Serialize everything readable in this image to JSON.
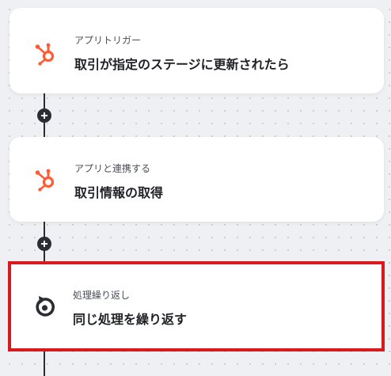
{
  "flow": {
    "steps": [
      {
        "app_label": "アプリトリガー",
        "title": "取引が指定のステージに更新されたら",
        "icon": "hubspot-icon",
        "icon_color": "#ff5c35"
      },
      {
        "app_label": "アプリと連携する",
        "title": "取引情報の取得",
        "icon": "hubspot-icon",
        "icon_color": "#ff5c35"
      },
      {
        "app_label": "処理繰り返し",
        "title": "同じ処理を繰り返す",
        "icon": "loop-icon",
        "icon_color": "#2b2d33",
        "selected": true,
        "highlight_color": "#d9191e"
      }
    ],
    "add_step_icon": "plus-icon"
  }
}
